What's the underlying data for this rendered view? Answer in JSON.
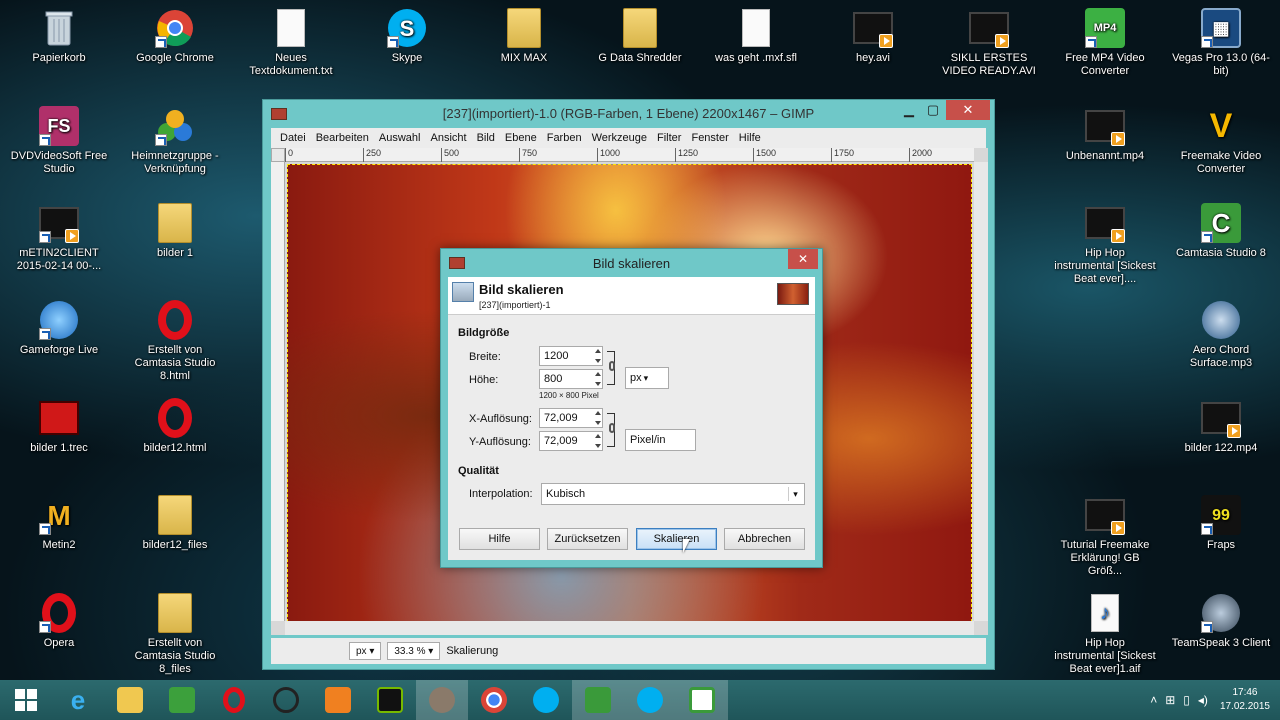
{
  "desktop": {
    "left_icons": [
      {
        "label": "Papierkorb",
        "icon": "recycle-bin-icon"
      },
      {
        "label": "Google Chrome",
        "icon": "chrome-icon"
      },
      {
        "label": "Neues Textdokument.txt",
        "icon": "text-file-icon"
      },
      {
        "label": "Skype",
        "icon": "skype-icon"
      },
      {
        "label": "MIX MAX",
        "icon": "folder-icon"
      },
      {
        "label": "G Data Shredder",
        "icon": "folder-icon"
      },
      {
        "label": "was geht .mxf.sfl",
        "icon": "file-icon"
      },
      {
        "label": "hey.avi",
        "icon": "video-file-icon"
      },
      {
        "label": "SIKLL ERSTES VIDEO READY.AVI",
        "icon": "video-file-icon"
      },
      {
        "label": "Free MP4 Video Converter",
        "icon": "mp4-converter-icon"
      },
      {
        "label": "Vegas Pro 13.0 (64-bit)",
        "icon": "vegas-icon"
      },
      {
        "label": "DVDVideoSoft Free Studio",
        "icon": "dvdvideosoft-icon"
      },
      {
        "label": "Heimnetzgruppe - Verknüpfung",
        "icon": "homegroup-icon"
      },
      {
        "label": "Unbenannt.mp4",
        "icon": "video-file-icon"
      },
      {
        "label": "Freemake Video Converter",
        "icon": "freemake-icon"
      },
      {
        "label": "mETIN2CLIENT 2015-02-14 00-...",
        "icon": "video-file-icon"
      },
      {
        "label": "bilder 1",
        "icon": "folder-icon"
      },
      {
        "label": "Hip Hop instrumental [Sickest Beat ever]....",
        "icon": "video-file-icon"
      },
      {
        "label": "Camtasia Studio 8",
        "icon": "camtasia-icon"
      },
      {
        "label": "Gameforge Live",
        "icon": "gameforge-icon"
      },
      {
        "label": "Erstellt von Camtasia Studio 8.html",
        "icon": "opera-icon"
      },
      {
        "label": "Aero Chord Surface.mp3",
        "icon": "audio-file-icon"
      },
      {
        "label": "bilder 1.trec",
        "icon": "trec-file-icon"
      },
      {
        "label": "bilder12.html",
        "icon": "opera-icon"
      },
      {
        "label": "bilder 122.mp4",
        "icon": "video-file-icon"
      },
      {
        "label": "Metin2",
        "icon": "metin2-icon"
      },
      {
        "label": "bilder12_files",
        "icon": "folder-icon"
      },
      {
        "label": "Tuturial Freemake Erklärung! GB Größ...",
        "icon": "video-file-icon"
      },
      {
        "label": "Fraps",
        "icon": "fraps-icon"
      },
      {
        "label": "Opera",
        "icon": "opera-icon"
      },
      {
        "label": "Erstellt von Camtasia Studio 8_files",
        "icon": "folder-icon"
      },
      {
        "label": "Hip Hop instrumental [Sickest Beat ever]1.aif",
        "icon": "audio-file-icon"
      },
      {
        "label": "TeamSpeak 3 Client",
        "icon": "teamspeak-icon"
      }
    ]
  },
  "gimp": {
    "title": "[237](importiert)-1.0 (RGB-Farben, 1 Ebene) 2200x1467 – GIMP",
    "menu": [
      "Datei",
      "Bearbeiten",
      "Auswahl",
      "Ansicht",
      "Bild",
      "Ebene",
      "Farben",
      "Werkzeuge",
      "Filter",
      "Fenster",
      "Hilfe"
    ],
    "ruler_ticks": [
      "0",
      "250",
      "500",
      "750",
      "1000",
      "1250",
      "1500",
      "1750",
      "2000"
    ],
    "status": {
      "unit": "px",
      "zoom": "33.3 %",
      "message": "Skalierung"
    }
  },
  "dialog": {
    "window_title": "Bild skalieren",
    "header_title": "Bild skalieren",
    "header_subtitle": "[237](importiert)-1",
    "section_size": "Bildgröße",
    "width_label": "Breite:",
    "width_value": "1200",
    "height_label": "Höhe:",
    "height_value": "800",
    "size_unit": "px",
    "size_note": "1200 × 800 Pixel",
    "xres_label": "X-Auflösung:",
    "xres_value": "72,009",
    "yres_label": "Y-Auflösung:",
    "yres_value": "72,009",
    "res_unit": "Pixel/in",
    "section_quality": "Qualität",
    "interp_label": "Interpolation:",
    "interp_value": "Kubisch",
    "buttons": {
      "help": "Hilfe",
      "reset": "Zurücksetzen",
      "scale": "Skalieren",
      "cancel": "Abbrechen"
    }
  },
  "taskbar": {
    "apps": [
      "start-icon",
      "internet-explorer-icon",
      "file-explorer-icon",
      "store-icon",
      "opera-icon",
      "steam-icon",
      "media-icon",
      "nvidia-icon",
      "gimp-icon",
      "chrome-icon",
      "skype-icon",
      "camtasia-icon",
      "skype-icon",
      "camtasia-recorder-icon"
    ],
    "time": "17:46",
    "date": "17.02.2015"
  }
}
